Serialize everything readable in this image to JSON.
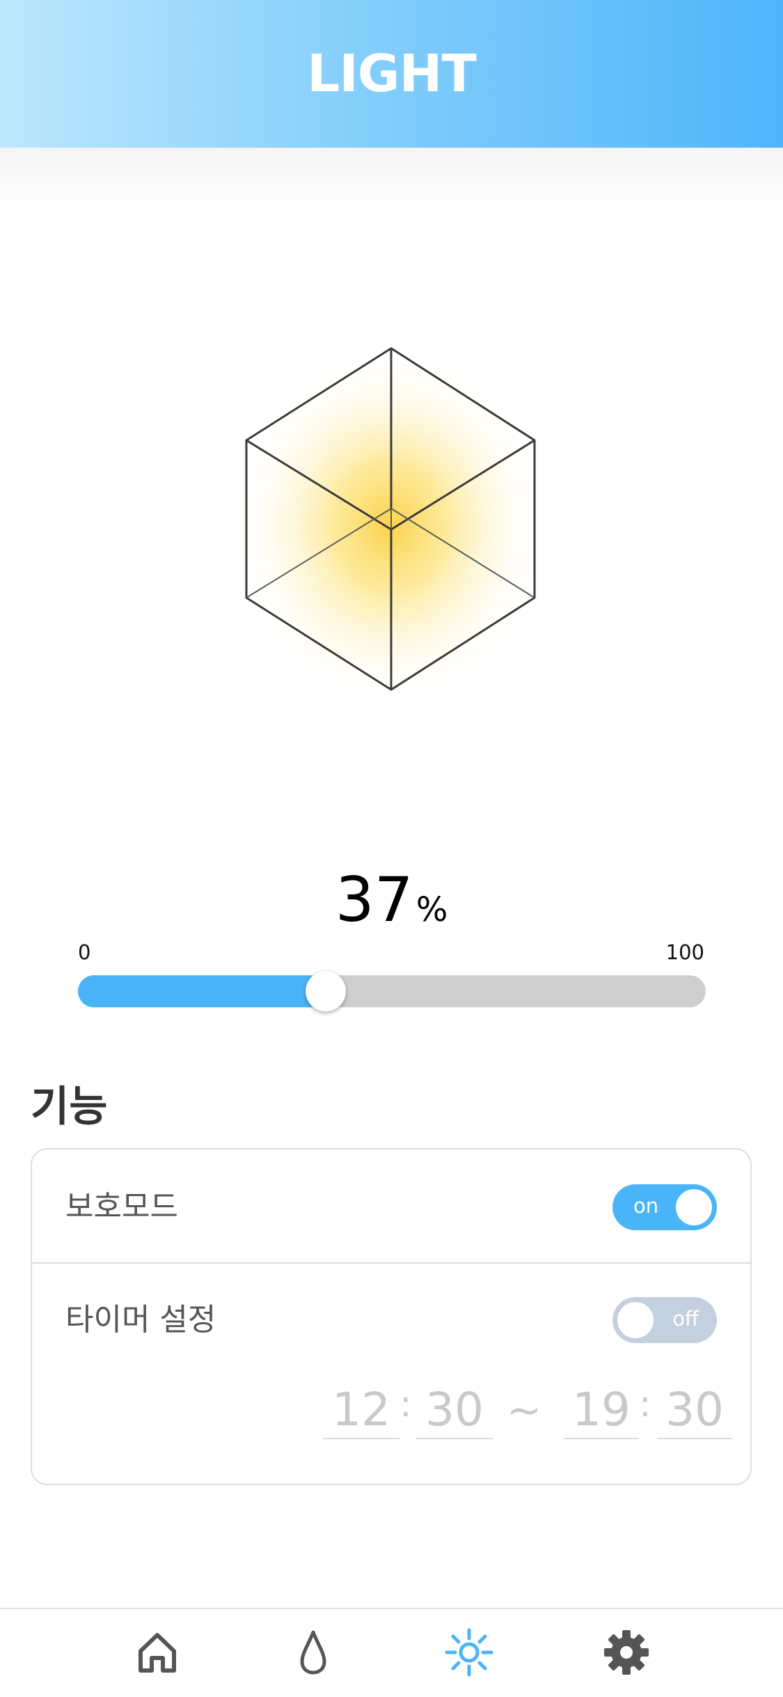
{
  "header": {
    "title": "LIGHT"
  },
  "brightness": {
    "value": "37",
    "unit": "%",
    "fraction": 0.37,
    "min_label": "0",
    "max_label": "100"
  },
  "features": {
    "section_title": "기능",
    "protect_mode": {
      "label": "보호모드",
      "toggle_text": "on"
    },
    "timer": {
      "label": "타이머 설정",
      "toggle_text": "off",
      "start_hour": "12",
      "start_minute": "30",
      "separator": "~",
      "end_hour": "19",
      "end_minute": "30",
      "colon": ":"
    }
  },
  "nav": {
    "items": [
      {
        "icon": "home-icon"
      },
      {
        "icon": "water-drop-icon"
      },
      {
        "icon": "sun-icon",
        "active": true
      },
      {
        "icon": "gear-icon"
      }
    ],
    "active_color": "#4ab4f8",
    "inactive_color": "#555555"
  },
  "colors": {
    "accent": "#4ab4f8",
    "toggle_off": "#c4d0de",
    "glow": "#fcd34d"
  }
}
